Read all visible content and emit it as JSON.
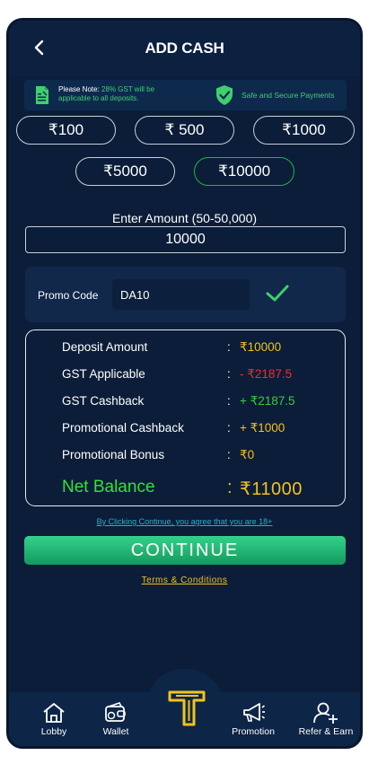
{
  "header": {
    "title": "ADD CASH"
  },
  "notice": {
    "prefix": "Please Note:",
    "highlight": "28% GST will be",
    "suffix": "applicable to all deposits.",
    "secure": "Safe and Secure Payments"
  },
  "chips": {
    "c100": "₹100",
    "c500": "₹ 500",
    "c1000": "₹1000",
    "c5000": "₹5000",
    "c10000": "₹10000",
    "selected": "₹10000"
  },
  "amount": {
    "label": "Enter Amount (50-50,000)",
    "value": "10000"
  },
  "promo": {
    "label": "Promo Code",
    "value": "DA10"
  },
  "summary": {
    "rows": [
      {
        "label": "Deposit Amount",
        "colon": ":",
        "value": "₹10000"
      },
      {
        "label": "GST Applicable",
        "colon": ":",
        "value": "- ₹2187.5"
      },
      {
        "label": "GST Cashback",
        "colon": ":",
        "value": "+ ₹2187.5"
      },
      {
        "label": "Promotional Cashback",
        "colon": ":",
        "value": "+ ₹1000"
      },
      {
        "label": "Promotional Bonus",
        "colon": ":",
        "value": "₹0"
      }
    ],
    "net": {
      "label": "Net Balance",
      "colon": ":",
      "value": "₹11000"
    }
  },
  "agreement": "By Clicking Continue, you agree that you are 18+",
  "continue_label": "CONTINUE",
  "terms": "Terms & Conditions",
  "nav": {
    "lobby": "Lobby",
    "wallet": "Wallet",
    "promotion": "Promotion",
    "refer": "Refer & Earn"
  },
  "icons": [
    "back-arrow-icon",
    "document-icon",
    "shield-check-icon",
    "checkmark-icon",
    "home-icon",
    "wallet-icon",
    "app-logo-icon",
    "megaphone-icon",
    "add-user-icon"
  ],
  "colors": {
    "accent_green": "#3fcf6d",
    "gold": "#f3c21d",
    "red": "#f52a2a",
    "background": "#0b1d38"
  }
}
